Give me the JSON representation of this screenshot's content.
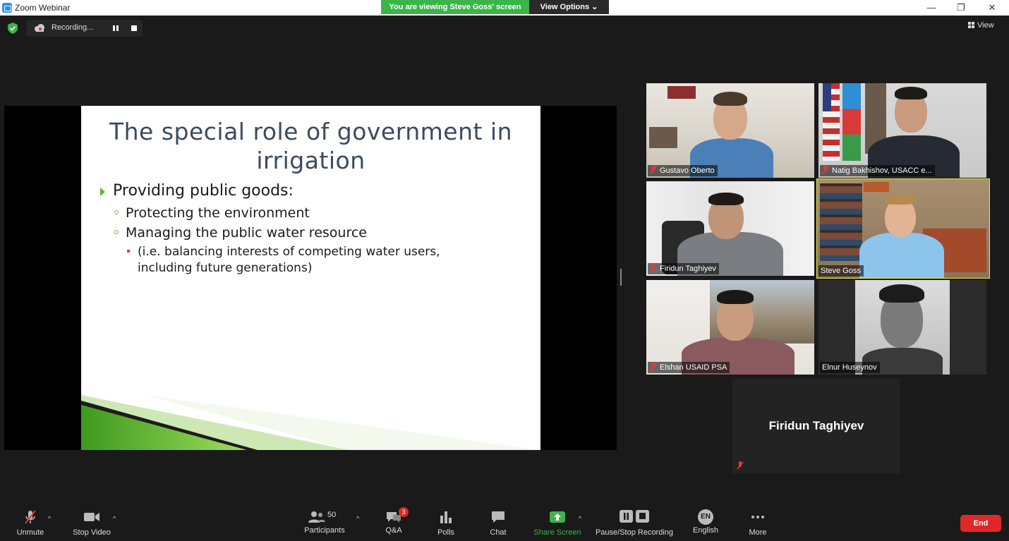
{
  "window": {
    "title": "Zoom Webinar",
    "viewing_banner": "You are viewing Steve Goss' screen",
    "view_options": "View Options ⌄",
    "minimize": "—",
    "restore": "❐",
    "close": "✕"
  },
  "status": {
    "recording_label": "Recording...",
    "view_label": "View"
  },
  "slide": {
    "title_line1": "The special role of government in",
    "title_line2": "irrigation",
    "bullet1": "Providing public goods:",
    "bullet2": "Protecting the environment",
    "bullet3": "Managing the public water resource",
    "bullet4": "(i.e. balancing interests of competing water users, including future generations)",
    "colors": {
      "title": "#3b4a5e",
      "accent_green": "#5cb82e",
      "accent_red": "#e0335f"
    }
  },
  "participants_video": [
    {
      "name": "Gustavo Oberto",
      "muted": true
    },
    {
      "name": "Natig Bakhishov, USACC e...",
      "muted": true
    },
    {
      "name": "Firidun Taghiyev",
      "muted": true
    },
    {
      "name": "Steve Goss",
      "muted": false,
      "active_speaker": true
    },
    {
      "name": "Elshan USAID PSA",
      "muted": true
    },
    {
      "name": "Elnur Huseynov",
      "muted": false
    }
  ],
  "placeholder_tile": {
    "name": "Firidun Taghiyev",
    "muted": true
  },
  "toolbar": {
    "unmute": "Unmute",
    "stop_video": "Stop Video",
    "participants": "Participants",
    "participants_count": "50",
    "qa": "Q&A",
    "qa_badge": "3",
    "polls": "Polls",
    "chat": "Chat",
    "share_screen": "Share Screen",
    "pause_stop_recording": "Pause/Stop Recording",
    "language_code": "EN",
    "language": "English",
    "more": "More",
    "end": "End",
    "share_color": "#3bb54a",
    "end_color": "#e02828"
  }
}
